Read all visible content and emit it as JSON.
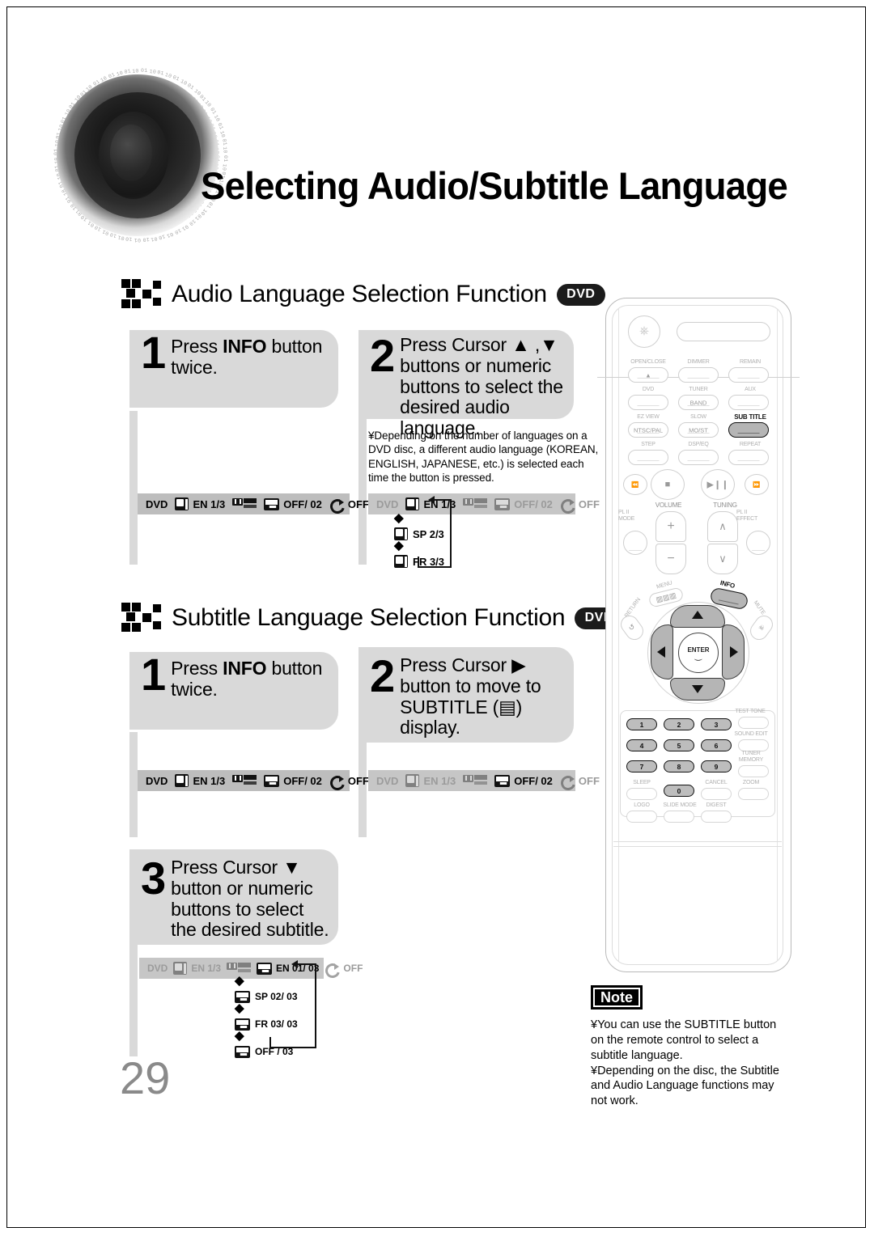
{
  "page": {
    "number": "29"
  },
  "header": {
    "title": "Selecting Audio/Subtitle Language",
    "speaker_icon": "speaker-cone-icon"
  },
  "sections": [
    {
      "id": "audio",
      "title": "Audio Language Selection Function",
      "badge": "DVD",
      "steps": [
        {
          "num": "1",
          "line1_a": "Press ",
          "line1_b": "INFO",
          "line1_c": " button",
          "line2": "twice."
        },
        {
          "num": "2",
          "lines": [
            "Press Cursor ▲ ,▼",
            "buttons or numeric",
            "buttons to select the",
            "desired audio language."
          ]
        }
      ],
      "note": "¥Depending on the number of languages on a\n  DVD disc, a different audio language (KOREAN,\n  ENGLISH, JAPANESE, etc.) is selected each\n  time the button is pressed.",
      "osd_left": {
        "disc": "DVD",
        "audio": "EN 1/3",
        "subtitle": "OFF/ 02",
        "repeat": "OFF"
      },
      "osd_right": {
        "disc": "DVD",
        "audio": "EN 1/3",
        "subtitle": "OFF/ 02",
        "repeat": "OFF"
      },
      "chain": [
        "SP 2/3",
        "FR 3/3"
      ]
    },
    {
      "id": "subtitle",
      "title": "Subtitle Language Selection Function",
      "badge": "DVD",
      "steps": [
        {
          "num": "1",
          "line1_a": "Press ",
          "line1_b": "INFO",
          "line1_c": " button",
          "line2": "twice."
        },
        {
          "num": "2",
          "lines": [
            "Press Cursor ▶",
            "button to move to",
            "SUBTITLE (▤)",
            "display."
          ]
        },
        {
          "num": "3",
          "lines": [
            "Press Cursor ▼",
            "button or numeric",
            "buttons to select",
            "the desired subtitle."
          ]
        }
      ],
      "osd_left": {
        "disc": "DVD",
        "audio": "EN 1/3",
        "subtitle": "OFF/ 02",
        "repeat": "OFF"
      },
      "osd_right": {
        "disc": "DVD",
        "audio": "EN 1/3",
        "subtitle": "OFF/ 02",
        "repeat": "OFF"
      },
      "osd_step3": {
        "disc": "DVD",
        "audio": "EN 1/3",
        "subtitle": "EN 01/ 03",
        "repeat": "OFF"
      },
      "chain": [
        "SP 02/ 03",
        "FR 03/ 03",
        "OFF / 03"
      ]
    }
  ],
  "note_box": {
    "tag": "Note",
    "body": "¥You can use the SUBTITLE button\n  on the remote control to select a\n  subtitle language.\n¥Depending on the disc, the Subtitle\n  and Audio Language functions may\n  not work."
  },
  "remote": {
    "power": "power-icon",
    "rows": [
      {
        "labels": [
          "OPEN/CLOSE",
          "DIMMER",
          "REMAIN"
        ]
      },
      {
        "labels": [
          "DVD",
          "TUNER",
          "AUX"
        ],
        "inner": [
          "",
          "BAND",
          ""
        ]
      },
      {
        "labels": [
          "EZ VIEW",
          "SLOW",
          "SUB TITLE"
        ],
        "inner": [
          "NTSC/PAL",
          "MO/ST",
          ""
        ]
      },
      {
        "labels": [
          "STEP",
          "DSP/EQ",
          "REPEAT"
        ]
      }
    ],
    "transport": [
      "prev-icon",
      "stop-icon",
      "play-pause-icon",
      "next-icon"
    ],
    "volume_label": "VOLUME",
    "tuning_label": "TUNING",
    "pl2_mode": "PL II\nMODE",
    "pl2_effect": "PL II\nEFFECT",
    "menu": "MENU",
    "info": "INFO",
    "return": "RETURN",
    "mute": "MUTE",
    "enter": "ENTER",
    "keypad": [
      "1",
      "2",
      "3",
      "4",
      "5",
      "6",
      "7",
      "8",
      "9",
      "0"
    ],
    "side_labels": [
      "TEST TONE",
      "SOUND EDIT",
      "TUNER\nMEMORY",
      "ZOOM"
    ],
    "bottom_labels": [
      "SLEEP",
      "CANCEL",
      "LOGO",
      "SLIDE MODE",
      "DIGEST"
    ]
  },
  "colors": {
    "step_bg": "#d9d9d9",
    "osd_bg": "#bdbdbd",
    "badge_bg": "#1b1b1b",
    "page_no": "#8a8a8a"
  }
}
